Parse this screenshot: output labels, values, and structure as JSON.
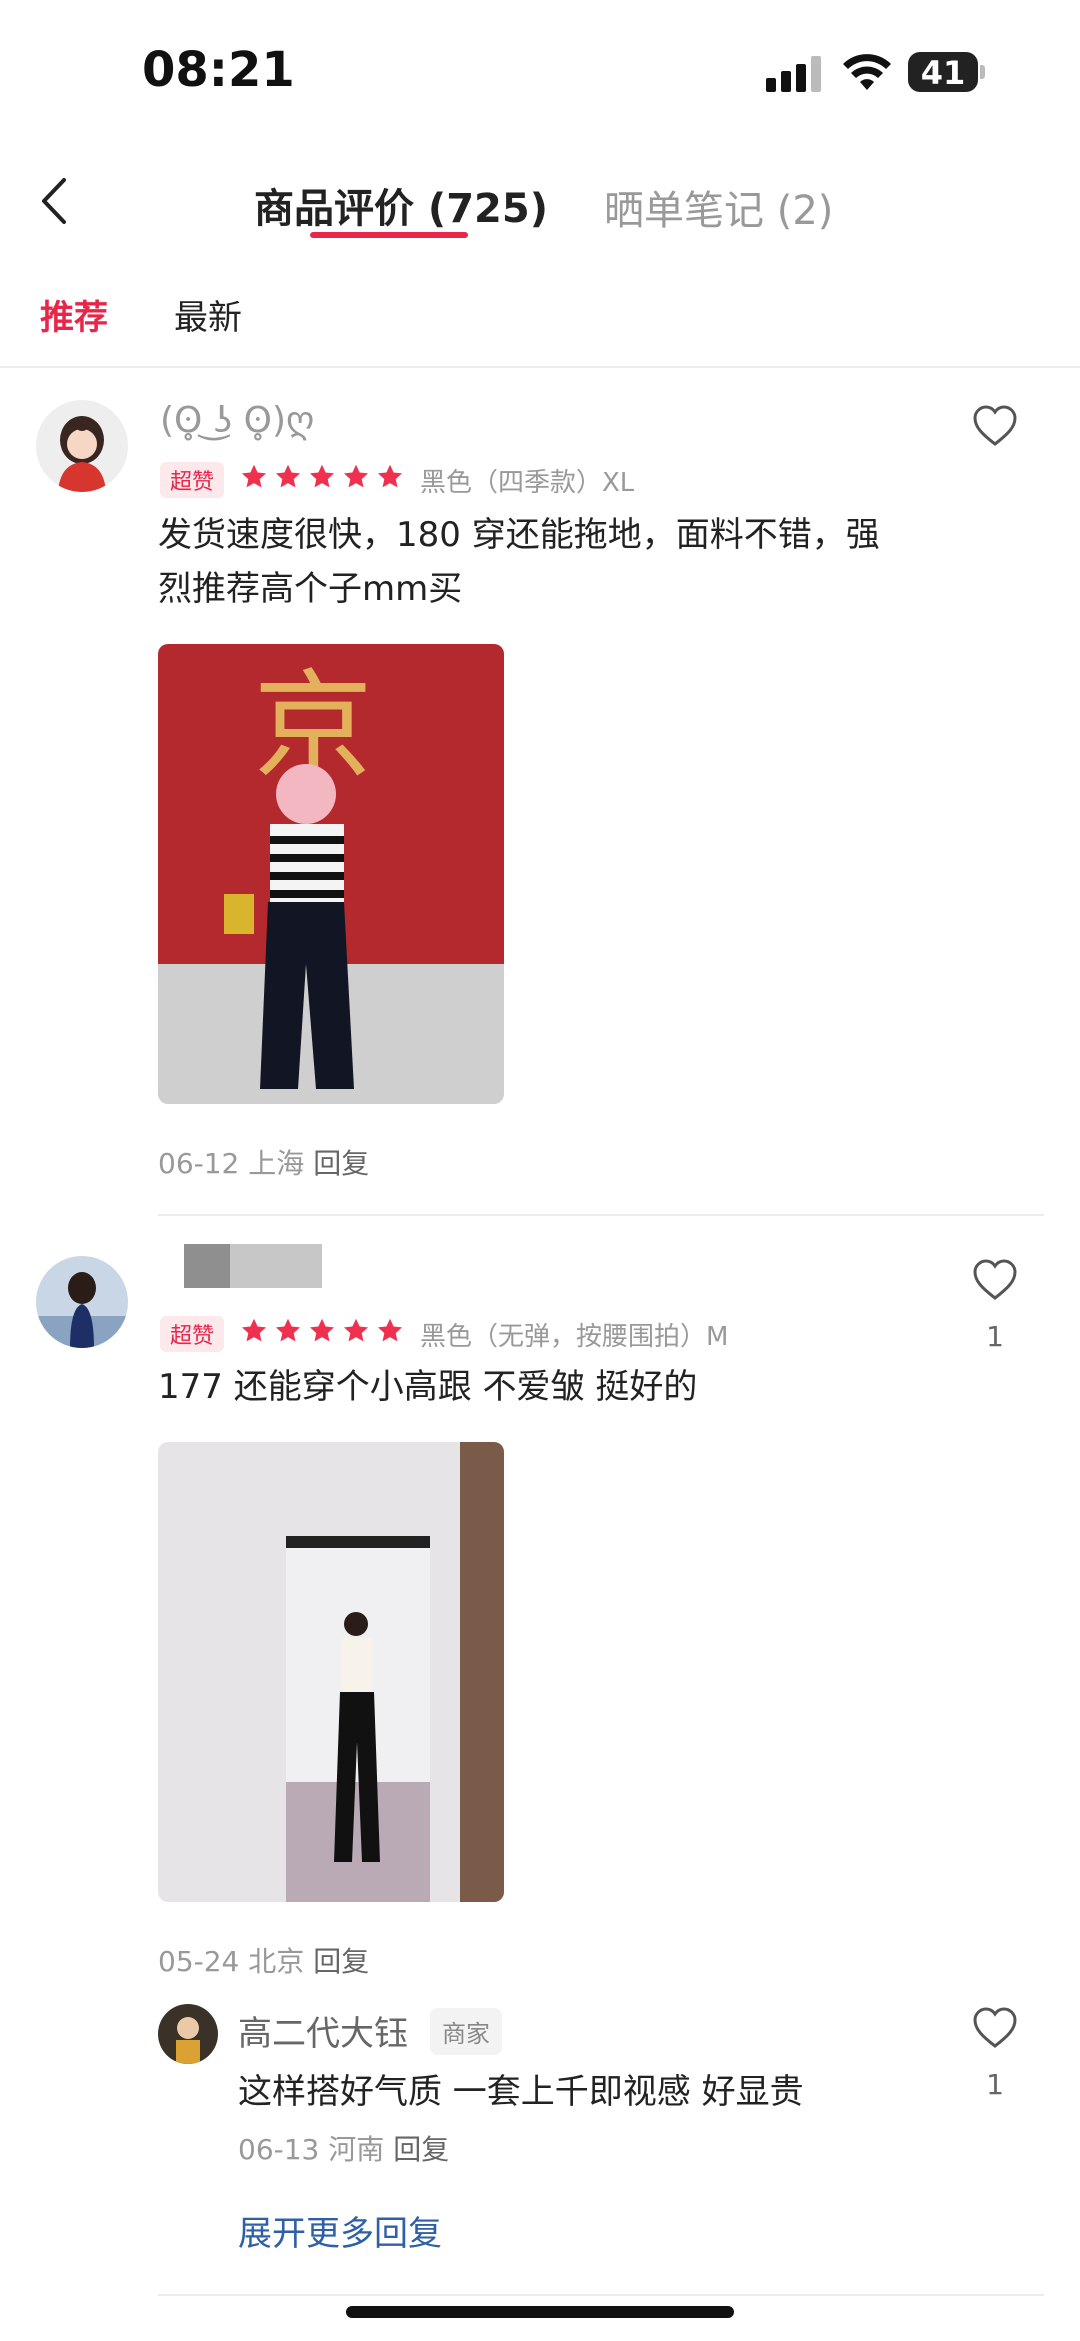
{
  "status_bar": {
    "time": "08:21",
    "battery": "41"
  },
  "header": {
    "tabs": [
      {
        "label": "商品评价 (725)",
        "active": true
      },
      {
        "label": "晒单笔记 (2)",
        "active": false
      }
    ],
    "sort": [
      {
        "label": "推荐",
        "active": true
      },
      {
        "label": "最新",
        "active": false
      }
    ]
  },
  "reviews": [
    {
      "username": "(ʘ̥ ͜ʖ ʘ̥)ღ",
      "badge": "超赞",
      "rating": 5,
      "sku": "黑色（四季款）XL",
      "content_lines": [
        "发货速度很快，180 穿还能拖地，面料不错，强",
        "烈推荐高个子mm买"
      ],
      "photo_text": "京",
      "meta": {
        "date": "06-12",
        "location": "上海",
        "reply": "回复"
      }
    },
    {
      "username": "",
      "badge": "超赞",
      "rating": 5,
      "sku": "黑色（无弹，按腰围拍）M",
      "content": "177 还能穿个小高跟 不爱皱 挺好的",
      "meta": {
        "date": "05-24",
        "location": "北京",
        "reply": "回复"
      },
      "likes": "1",
      "reply": {
        "name": "高二代大钰",
        "tag": "商家",
        "text": "这样搭好气质 一套上千即视感 好显贵",
        "date": "06-13",
        "location": "河南",
        "reply": "回复",
        "likes": "1"
      },
      "expand": "展开更多回复"
    }
  ],
  "colors": {
    "accent": "#e8264a",
    "link": "#2f5fa6"
  }
}
